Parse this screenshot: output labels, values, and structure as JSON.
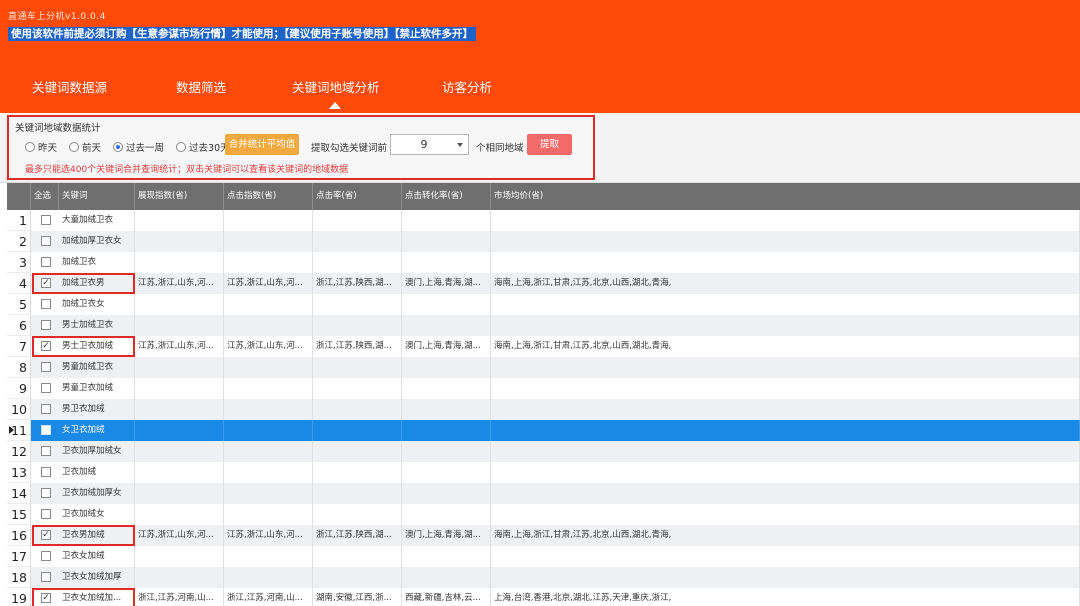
{
  "window": {
    "title": "直通车上分机v1.0.0.4",
    "notice": "使用该软件前提必须订购【生意参谋市场行情】才能使用；【建议使用子账号使用】【禁止软件多开】"
  },
  "tabs": [
    {
      "label": "关键词数据源"
    },
    {
      "label": "数据筛选"
    },
    {
      "label": "关键词地域分析"
    },
    {
      "label": "访客分析"
    }
  ],
  "filter": {
    "legend": "关键词地域数据统计",
    "radios": [
      {
        "label": "昨天",
        "checked": false
      },
      {
        "label": "前天",
        "checked": false
      },
      {
        "label": "过去一周",
        "checked": true
      },
      {
        "label": "过去30天",
        "checked": false
      }
    ],
    "merge_button": "合并统计平均值",
    "extract_label": "提取勾选关键词前",
    "count_value": "9",
    "same_region_label": "个相同地域",
    "extract_button": "提取",
    "warning": "最多只能选400个关键词合并查询统计；双击关键词可以查看该关键词的地域数据"
  },
  "grid": {
    "columns": [
      "全选",
      "关键词",
      "展现指数(省)",
      "点击指数(省)",
      "点击率(省)",
      "点击转化率(省)",
      "市场均价(省)"
    ],
    "rows": [
      {
        "num": "1",
        "checked": false,
        "keyword": "大童加绒卫衣",
        "c1": "",
        "c2": "",
        "c3": "",
        "c4": "",
        "c5": ""
      },
      {
        "num": "2",
        "checked": false,
        "keyword": "加绒加厚卫衣女",
        "c1": "",
        "c2": "",
        "c3": "",
        "c4": "",
        "c5": ""
      },
      {
        "num": "3",
        "checked": false,
        "keyword": "加绒卫衣",
        "c1": "",
        "c2": "",
        "c3": "",
        "c4": "",
        "c5": ""
      },
      {
        "num": "4",
        "checked": true,
        "keyword": "加绒卫衣男",
        "c1": "江苏,浙江,山东,河...",
        "c2": "江苏,浙江,山东,河...",
        "c3": "浙江,江苏,陕西,湖...",
        "c4": "澳门,上海,青海,湖...",
        "c5": "海南,上海,浙江,甘肃,江苏,北京,山西,湖北,青海,"
      },
      {
        "num": "5",
        "checked": false,
        "keyword": "加绒卫衣女",
        "c1": "",
        "c2": "",
        "c3": "",
        "c4": "",
        "c5": ""
      },
      {
        "num": "6",
        "checked": false,
        "keyword": "男士加绒卫衣",
        "c1": "",
        "c2": "",
        "c3": "",
        "c4": "",
        "c5": ""
      },
      {
        "num": "7",
        "checked": true,
        "keyword": "男士卫衣加绒",
        "c1": "江苏,浙江,山东,河...",
        "c2": "江苏,浙江,山东,河...",
        "c3": "浙江,江苏,陕西,湖...",
        "c4": "澳门,上海,青海,湖...",
        "c5": "海南,上海,浙江,甘肃,江苏,北京,山西,湖北,青海,"
      },
      {
        "num": "8",
        "checked": false,
        "keyword": "男童加绒卫衣",
        "c1": "",
        "c2": "",
        "c3": "",
        "c4": "",
        "c5": ""
      },
      {
        "num": "9",
        "checked": false,
        "keyword": "男童卫衣加绒",
        "c1": "",
        "c2": "",
        "c3": "",
        "c4": "",
        "c5": ""
      },
      {
        "num": "10",
        "checked": false,
        "keyword": "男卫衣加绒",
        "c1": "",
        "c2": "",
        "c3": "",
        "c4": "",
        "c5": ""
      },
      {
        "num": "11",
        "checked": false,
        "keyword": "女卫衣加绒",
        "c1": "",
        "c2": "",
        "c3": "",
        "c4": "",
        "c5": ""
      },
      {
        "num": "12",
        "checked": false,
        "keyword": "卫衣加厚加绒女",
        "c1": "",
        "c2": "",
        "c3": "",
        "c4": "",
        "c5": ""
      },
      {
        "num": "13",
        "checked": false,
        "keyword": "卫衣加绒",
        "c1": "",
        "c2": "",
        "c3": "",
        "c4": "",
        "c5": ""
      },
      {
        "num": "14",
        "checked": false,
        "keyword": "卫衣加绒加厚女",
        "c1": "",
        "c2": "",
        "c3": "",
        "c4": "",
        "c5": ""
      },
      {
        "num": "15",
        "checked": false,
        "keyword": "卫衣加绒女",
        "c1": "",
        "c2": "",
        "c3": "",
        "c4": "",
        "c5": ""
      },
      {
        "num": "16",
        "checked": true,
        "keyword": "卫衣男加绒",
        "c1": "江苏,浙江,山东,河...",
        "c2": "江苏,浙江,山东,河...",
        "c3": "浙江,江苏,陕西,湖...",
        "c4": "澳门,上海,青海,湖...",
        "c5": "海南,上海,浙江,甘肃,江苏,北京,山西,湖北,青海,"
      },
      {
        "num": "17",
        "checked": false,
        "keyword": "卫衣女加绒",
        "c1": "",
        "c2": "",
        "c3": "",
        "c4": "",
        "c5": ""
      },
      {
        "num": "18",
        "checked": false,
        "keyword": "卫衣女加绒加厚",
        "c1": "",
        "c2": "",
        "c3": "",
        "c4": "",
        "c5": ""
      },
      {
        "num": "19",
        "checked": true,
        "keyword": "卫衣女加绒加...",
        "c1": "浙江,江苏,河南,山...",
        "c2": "浙江,江苏,河南,山...",
        "c3": "湖南,安徽,江西,浙...",
        "c4": "西藏,新疆,吉林,云...",
        "c5": "上海,台湾,香港,北京,湖北,江苏,天津,重庆,浙江,"
      }
    ],
    "selected_row": "11"
  },
  "colors": {
    "header_bg": "#ff4a0a",
    "notice_bg": "#1e63c8",
    "selected_row": "#1a8ae6",
    "highlight_border": "#e02a2a"
  }
}
